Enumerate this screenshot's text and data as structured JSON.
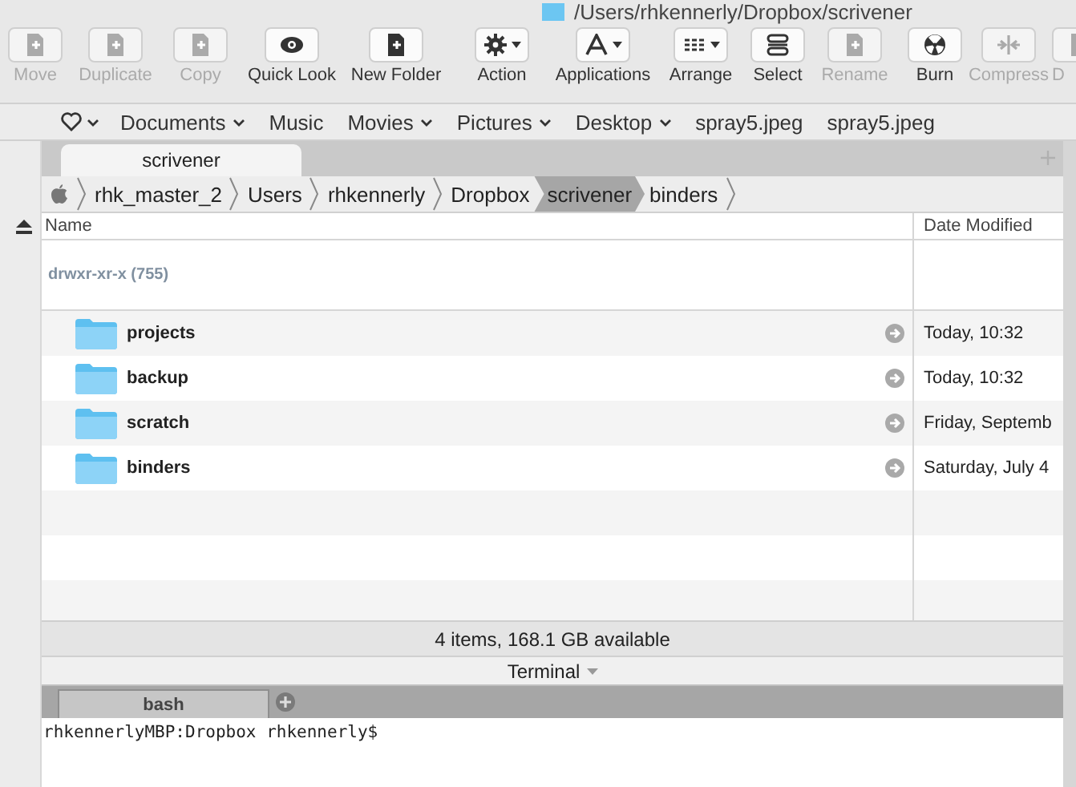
{
  "window": {
    "title": "/Users/rhkennerly/Dropbox/scrivener"
  },
  "toolbar": [
    {
      "label": "Move",
      "disabled": true,
      "has_menu": false
    },
    {
      "label": "Duplicate",
      "disabled": true,
      "has_menu": false
    },
    {
      "label": "Copy",
      "disabled": true,
      "has_menu": false
    },
    {
      "label": "Quick Look",
      "disabled": false,
      "has_menu": false
    },
    {
      "label": "New Folder",
      "disabled": false,
      "has_menu": false
    },
    {
      "label": "Action",
      "disabled": false,
      "has_menu": true
    },
    {
      "label": "Applications",
      "disabled": false,
      "has_menu": true
    },
    {
      "label": "Arrange",
      "disabled": false,
      "has_menu": true
    },
    {
      "label": "Select",
      "disabled": false,
      "has_menu": false
    },
    {
      "label": "Rename",
      "disabled": true,
      "has_menu": false
    },
    {
      "label": "Burn",
      "disabled": false,
      "has_menu": false
    },
    {
      "label": "Compress",
      "disabled": true,
      "has_menu": false
    },
    {
      "label": "D",
      "disabled": true,
      "has_menu": false
    }
  ],
  "favorites": [
    {
      "label": "Documents",
      "has_menu": true
    },
    {
      "label": "Music",
      "has_menu": false
    },
    {
      "label": "Movies",
      "has_menu": true
    },
    {
      "label": "Pictures",
      "has_menu": true
    },
    {
      "label": "Desktop",
      "has_menu": true
    },
    {
      "label": "spray5.jpeg",
      "has_menu": false
    },
    {
      "label": "spray5.jpeg",
      "has_menu": false
    }
  ],
  "tabs": [
    {
      "label": "scrivener",
      "selected": true
    }
  ],
  "path": [
    {
      "label": "rhk_master_2",
      "selected": false
    },
    {
      "label": "Users",
      "selected": false
    },
    {
      "label": "rhkennerly",
      "selected": false
    },
    {
      "label": "Dropbox",
      "selected": false
    },
    {
      "label": "scrivener",
      "selected": true
    },
    {
      "label": "binders",
      "selected": false
    }
  ],
  "table": {
    "columns": [
      "Name",
      "Date Modified"
    ],
    "permissions": "drwxr-xr-x (755)",
    "rows": [
      {
        "name": "projects",
        "date": "Today, 10:32"
      },
      {
        "name": "backup",
        "date": "Today, 10:32"
      },
      {
        "name": "scratch",
        "date": "Friday, Septemb"
      },
      {
        "name": "binders",
        "date": "Saturday, July 4"
      }
    ]
  },
  "status_bar": "4 items, 168.1 GB available",
  "terminal": {
    "title": "Terminal",
    "tabs": [
      {
        "label": "bash",
        "selected": true
      }
    ],
    "prompt": "rhkennerlyMBP:Dropbox rhkennerly$"
  }
}
